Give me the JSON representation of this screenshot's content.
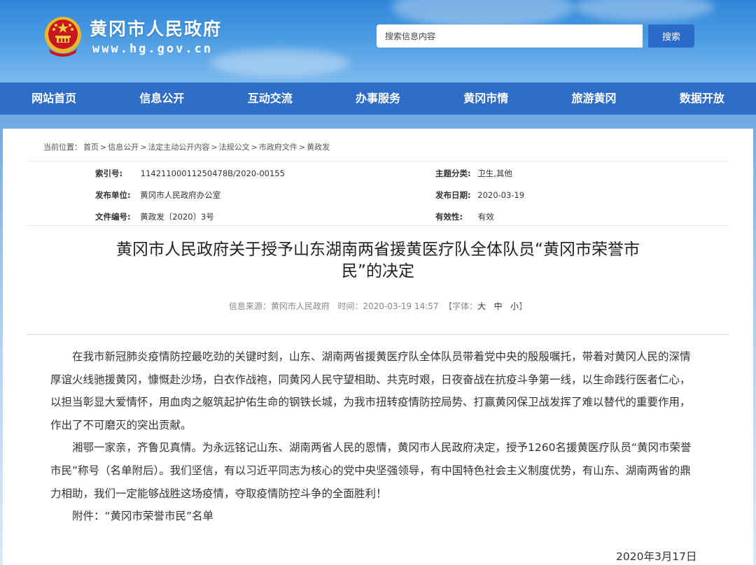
{
  "header": {
    "site_title": "黄冈市人民政府",
    "site_url": "www.hg.gov.cn",
    "search_placeholder": "搜索信息内容",
    "search_button": "搜索"
  },
  "nav": [
    "网站首页",
    "信息公开",
    "互动交流",
    "办事服务",
    "黄冈市情",
    "旅游黄冈",
    "数据开放"
  ],
  "breadcrumb": {
    "label": "当前位置：",
    "items": [
      "首页",
      "信息公开",
      "法定主动公开内容",
      "法规公文",
      "市政府文件",
      "黄政发"
    ],
    "separator": ">"
  },
  "meta": {
    "index_label": "索引号:",
    "index_value": "11421100011250478B/2020-00155",
    "topic_label": "主题分类:",
    "topic_value": "卫生,其他",
    "publisher_label": "发布单位:",
    "publisher_value": "黄冈市人民政府办公室",
    "date_label": "发布日期:",
    "date_value": "2020-03-19",
    "docno_label": "文件编号:",
    "docno_value": "黄政发〔2020〕3号",
    "validity_label": "有效性:",
    "validity_value": "有效"
  },
  "article": {
    "title_line1": "黄冈市人民政府关于授予山东湖南两省援黄医疗队全体队员“黄冈市荣誉市",
    "title_line2": "民”的决定",
    "source_label": "信息来源：",
    "source_value": "黄冈市人民政府",
    "time_label": "时间：",
    "time_value": "2020-03-19 14:57",
    "font_label": "【字体：",
    "font_large": "大",
    "font_medium": "中",
    "font_small": "小",
    "font_close": "】",
    "paragraphs": [
      "在我市新冠肺炎疫情防控最吃劲的关键时刻，山东、湖南两省援黄医疗队全体队员带着党中央的殷殷嘱托，带着对黄冈人民的深情厚谊火线驰援黄冈，慷慨赴沙场，白衣作战袍，同黄冈人民守望相助、共克时艰，日夜奋战在抗疫斗争第一线，以生命践行医者仁心，以担当彰显大爱情怀，用血肉之躯筑起护佑生命的钢铁长城，为我市扭转疫情防控局势、打赢黄冈保卫战发挥了难以替代的重要作用，作出了不可磨灭的突出贡献。",
      "湘鄂一家亲，齐鲁见真情。为永远铭记山东、湖南两省人民的恩情，黄冈市人民政府决定，授予1260名援黄医疗队员“黄冈市荣誉市民”称号（名单附后）。我们坚信，有以习近平同志为核心的党中央坚强领导，有中国特色社会主义制度优势，有山东、湖南两省的鼎力相助，我们一定能够战胜这场疫情，夺取疫情防控斗争的全面胜利！",
      "附件：“黄冈市荣誉市民”名单"
    ],
    "date": "2020年3月17日"
  },
  "colors": {
    "nav_bg": "#2e6ec8",
    "banner_top": "#2f86d8",
    "emblem_red": "#c8171e",
    "emblem_gold": "#e8b830"
  }
}
